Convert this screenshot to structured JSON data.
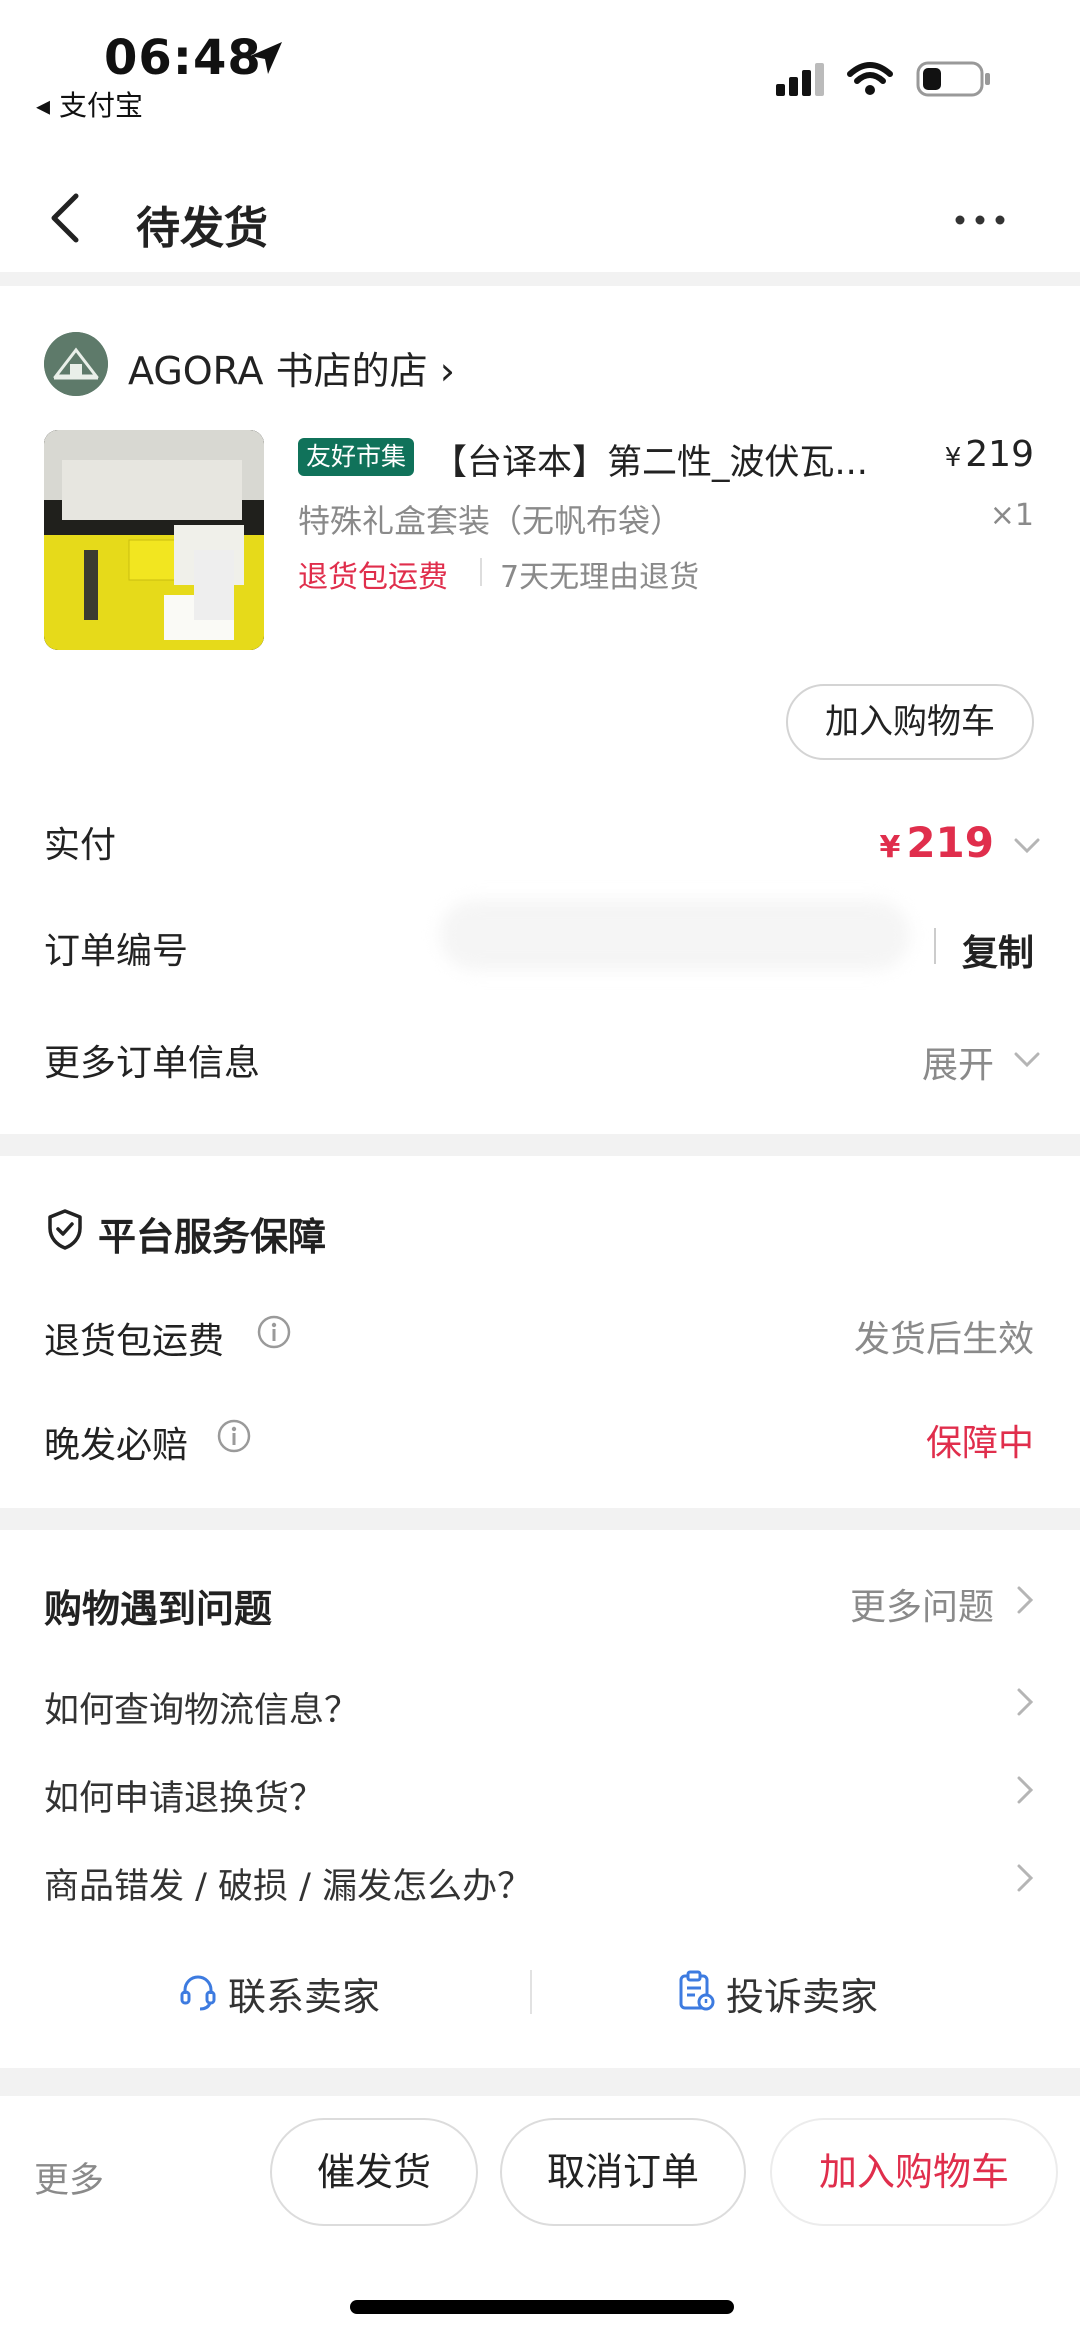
{
  "status_bar": {
    "time": "06:48",
    "back_app": "◂ 支付宝"
  },
  "header": {
    "title": "待发货"
  },
  "shop": {
    "name": "AGORA 书店的店 ›"
  },
  "product": {
    "tag": "友好市集",
    "title": "【台译本】第二性_波伏瓦...",
    "price_symbol": "¥",
    "price": "219",
    "variant": "特殊礼盒套装（无帆布袋）",
    "quantity": "×1",
    "return_fee": "退货包运费",
    "seven_day": "7天无理由退货",
    "add_to_cart": "加入购物车"
  },
  "order": {
    "paid_label": "实付",
    "paid_symbol": "¥",
    "paid_value": "219",
    "number_label": "订单编号",
    "copy": "复制",
    "more_info_label": "更多订单信息",
    "expand": "展开"
  },
  "guarantee": {
    "title": "平台服务保障",
    "items": [
      {
        "label": "退货包运费",
        "value": "发货后生效"
      },
      {
        "label": "晚发必赔",
        "value": "保障中"
      }
    ]
  },
  "help": {
    "title": "购物遇到问题",
    "more": "更多问题",
    "questions": [
      "如何查询物流信息？",
      "如何申请退换货？",
      "商品错发 / 破损 / 漏发怎么办？"
    ],
    "contact": "联系卖家",
    "complain": "投诉卖家"
  },
  "bottom_bar": {
    "more": "更多",
    "urge": "催发货",
    "cancel": "取消订单",
    "add_cart": "加入购物车"
  },
  "colors": {
    "accent_red": "#e02e4c",
    "tag_green": "#10725a"
  }
}
